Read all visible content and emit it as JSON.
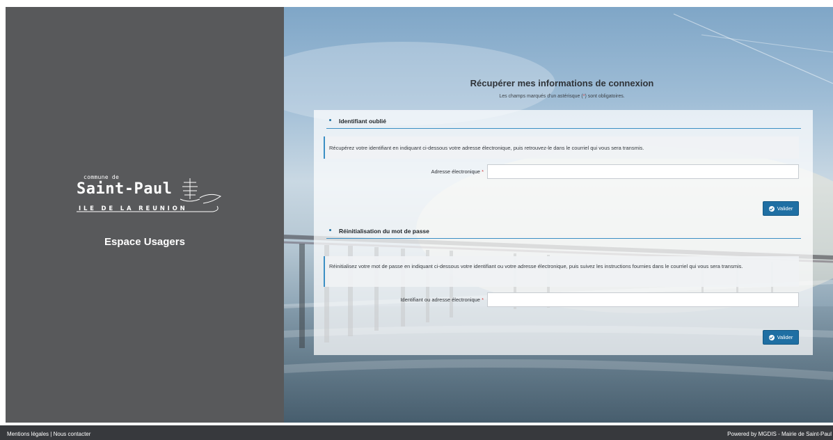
{
  "sidebar": {
    "logo": {
      "small": "commune de",
      "city": "Saint-Paul",
      "island": "ILE DE LA REUNION"
    },
    "subtitle": "Espace Usagers"
  },
  "form": {
    "title": "Récupérer mes informations de connexion",
    "required_note_before": "Les champs marqués d'un astérisque (",
    "required_mark": "*",
    "required_note_after": ") sont obligatoires.",
    "sections": [
      {
        "heading": "Identifiant oublié",
        "info": "Récupérez votre identifiant en indiquant ci-dessous votre adresse électronique, puis retrouvez-le dans le courriel qui vous sera transmis.",
        "field_label": "Adresse électronique",
        "field_value": "",
        "required": "*",
        "button": "Valider"
      },
      {
        "heading": "Réinitialisation du mot de passe",
        "info": "Réinitialisez votre mot de passe en indiquant ci-dessous votre identifiant ou votre adresse électronique, puis suivez les instructions fournies dans le courriel qui vous sera transmis.",
        "field_label": "Identifiant ou adresse électronique",
        "field_value": "",
        "required": "*",
        "button": "Valider"
      }
    ]
  },
  "footer": {
    "legal": "Mentions légales",
    "separator": "|",
    "contact": "Nous contacter",
    "powered": "Powered by MGDIS - Mairie de Saint-Paul"
  },
  "colors": {
    "sidebar_bg": "#58595b",
    "accent": "#1f6fa3",
    "footer_bg": "#37393d",
    "required": "#d23b3b"
  }
}
